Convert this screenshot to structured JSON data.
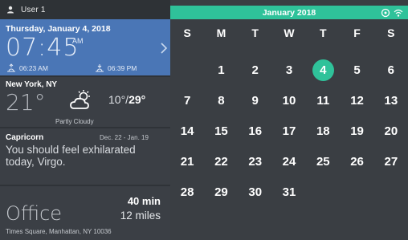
{
  "user": {
    "label": "User 1"
  },
  "date_card": {
    "date_text": "Thursday, January 4, 2018",
    "time": "07:45",
    "ampm": "AM",
    "sunrise": "06:23 AM",
    "sunset": "06:39 PM"
  },
  "weather": {
    "city": "New York, NY",
    "temp": "21°",
    "high": "10°",
    "low": "29°",
    "condition": "Partly Cloudy"
  },
  "horoscope": {
    "sign": "Capricorn",
    "range": "Dec. 22 - Jan. 19",
    "message": "You should feel exhilarated today, Virgo."
  },
  "commute": {
    "place": "Office",
    "minutes": "40 min",
    "miles": "12 miles",
    "address": "Times Square, Manhattan, NY 10036"
  },
  "calendar": {
    "title": "January 2018",
    "weekdays": [
      "S",
      "M",
      "T",
      "W",
      "T",
      "F",
      "S"
    ],
    "days": [
      "",
      "1",
      "2",
      "3",
      "4",
      "5",
      "6",
      "7",
      "8",
      "9",
      "10",
      "11",
      "12",
      "13",
      "14",
      "15",
      "16",
      "17",
      "18",
      "19",
      "20",
      "21",
      "22",
      "23",
      "24",
      "25",
      "26",
      "27",
      "28",
      "29",
      "30",
      "31"
    ],
    "today": "4",
    "accent_color": "#2fc29a"
  }
}
